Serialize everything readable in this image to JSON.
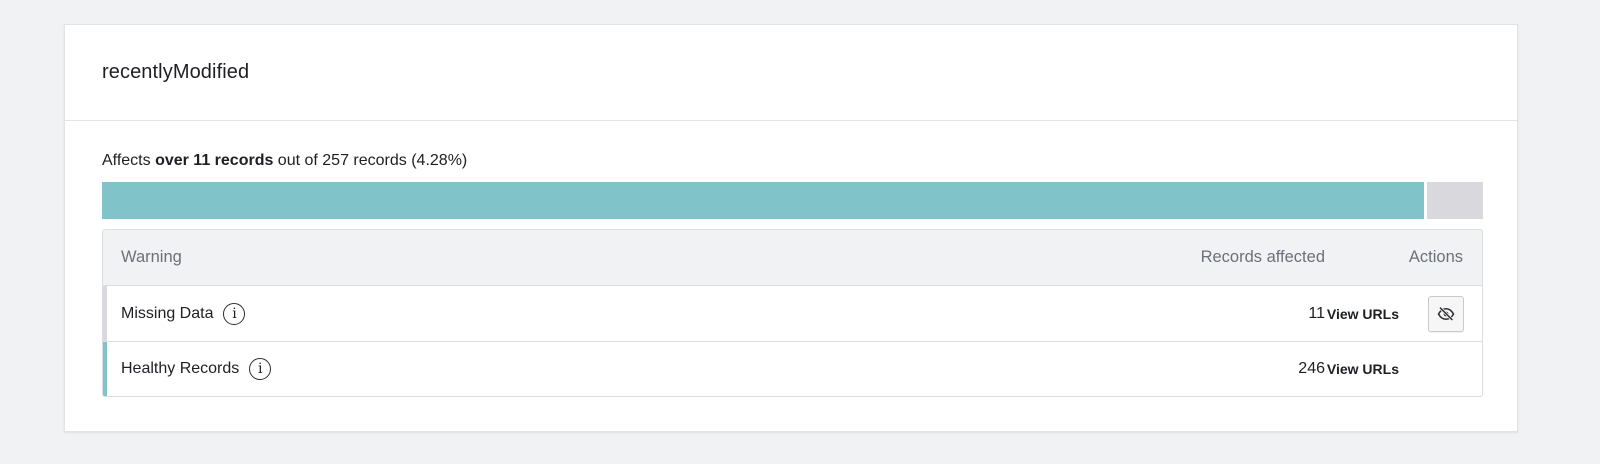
{
  "card": {
    "title": "recentlyModified"
  },
  "summary": {
    "prefix": "Affects ",
    "highlight": "over 11 records",
    "suffix": " out of 257 records (4.28%)"
  },
  "progress": {
    "healthy_fraction": 0.9572,
    "colors": {
      "healthy": "#80c3c8",
      "missing": "#d9d9dd"
    }
  },
  "table": {
    "headers": {
      "warning": "Warning",
      "records": "Records affected",
      "actions": "Actions"
    },
    "rows": [
      {
        "name": "Missing Data",
        "count": "11",
        "action": "View URLs",
        "accent": "#d9d9dd",
        "icon": "info-icon",
        "hide_icon": "eye-slash-icon"
      },
      {
        "name": "Healthy Records",
        "count": "246",
        "action": "View URLs",
        "accent": "#80c3c8",
        "icon": "info-icon"
      }
    ]
  }
}
